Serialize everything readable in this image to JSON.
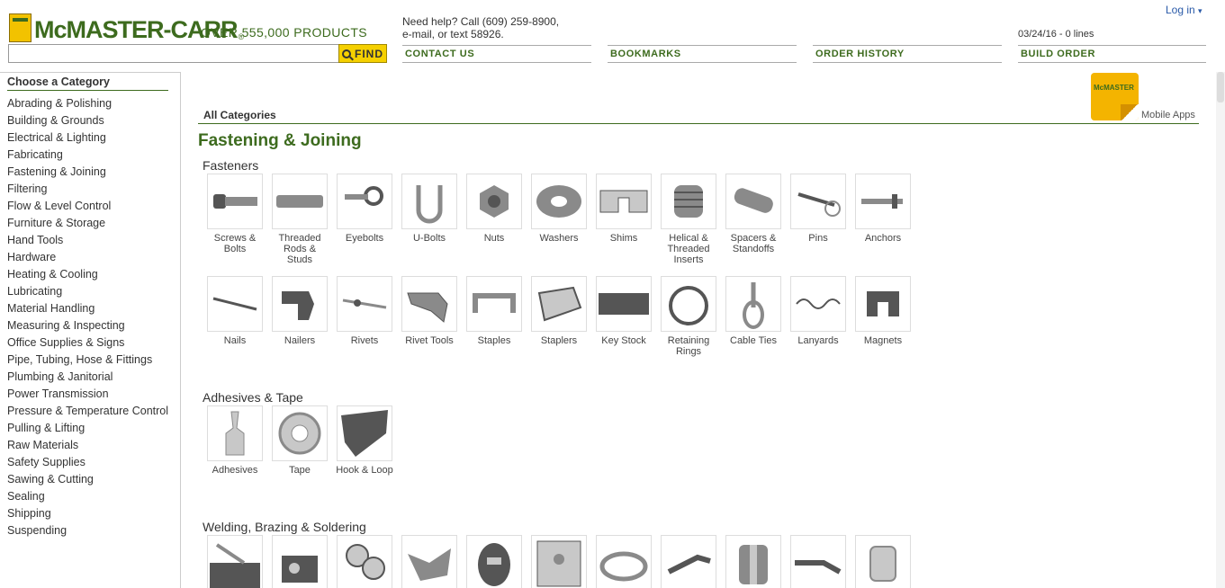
{
  "header": {
    "brand": "McMASTER-CARR",
    "tagline": "OVER 555,000 PRODUCTS",
    "find_label": "FIND",
    "help_line1": "Need help? Call (609) 259-8900,",
    "help_line2": "e-mail, or text 58926.",
    "nav": [
      "CONTACT US",
      "BOOKMARKS",
      "ORDER HISTORY",
      "BUILD ORDER"
    ],
    "login": "Log in",
    "order_status": "03/24/16 - 0 lines",
    "brand_color": "#3d6b1e",
    "accent": "#f5d000"
  },
  "sidebar": {
    "title": "Choose a Category",
    "items": [
      "Abrading & Polishing",
      "Building & Grounds",
      "Electrical & Lighting",
      "Fabricating",
      "Fastening & Joining",
      "Filtering",
      "Flow & Level Control",
      "Furniture & Storage",
      "Hand Tools",
      "Hardware",
      "Heating & Cooling",
      "Lubricating",
      "Material Handling",
      "Measuring & Inspecting",
      "Office Supplies & Signs",
      "Pipe, Tubing, Hose & Fittings",
      "Plumbing & Janitorial",
      "Power Transmission",
      "Pressure & Temperature Control",
      "Pulling & Lifting",
      "Raw Materials",
      "Safety Supplies",
      "Sawing & Cutting",
      "Sealing",
      "Shipping",
      "Suspending"
    ]
  },
  "main": {
    "breadcrumb": "All Categories",
    "mobile_tile": "McMASTER",
    "mobile_label": "Mobile Apps",
    "title": "Fastening & Joining",
    "sections": [
      {
        "title": "Fasteners",
        "items": [
          "Screws & Bolts",
          "Threaded Rods & Studs",
          "Eyebolts",
          "U-Bolts",
          "Nuts",
          "Washers",
          "Shims",
          "Helical & Threaded Inserts",
          "Spacers & Standoffs",
          "Pins",
          "Anchors",
          "Nails",
          "Nailers",
          "Rivets",
          "Rivet Tools",
          "Staples",
          "Staplers",
          "Key Stock",
          "Retaining Rings",
          "Cable Ties",
          "Lanyards",
          "Magnets"
        ]
      },
      {
        "title": "Adhesives & Tape",
        "items": [
          "Adhesives",
          "Tape",
          "Hook & Loop"
        ]
      },
      {
        "title": "Welding, Brazing & Soldering",
        "items": [
          "",
          "",
          "",
          "",
          "",
          "",
          "",
          "",
          "",
          "",
          ""
        ]
      }
    ]
  }
}
